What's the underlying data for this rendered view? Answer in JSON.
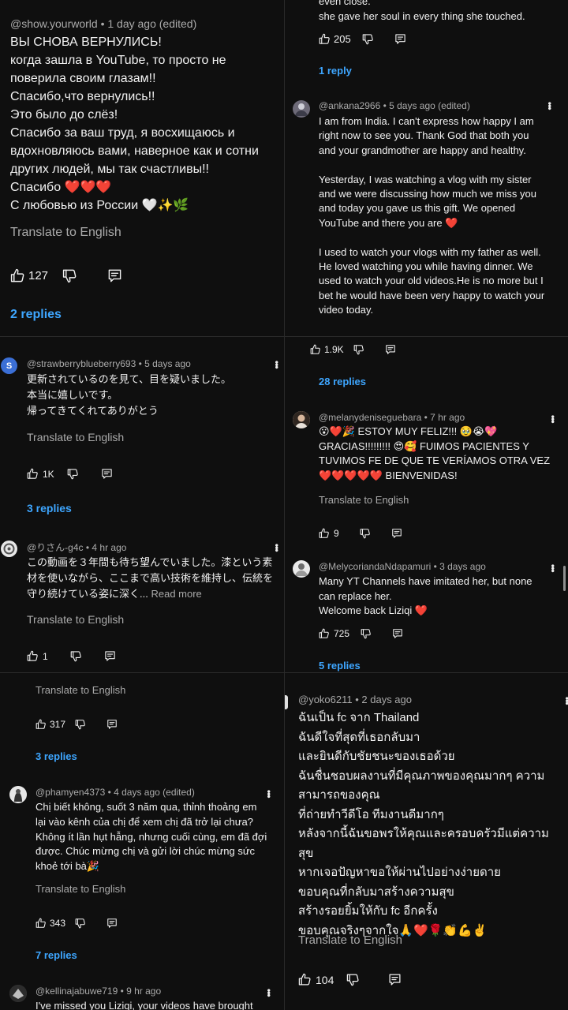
{
  "p1": {
    "meta": "@show.yourworld • 1 day ago (edited)",
    "text": "ВЫ СНОВА ВЕРНУЛИСЬ!\nкогда зашла в YouTube, то просто не поверила своим глазам!!\nСпасибо,что вернулись!!\nЭто было до слёз!\nСпасибо за ваш труд, я восхищаюсь и вдохновляюсь вами, наверное как и сотни других людей, мы так счастливы!!\nСпасибо ❤️❤️❤️\nС любовью из России 🤍✨🌿",
    "translate": "Translate to English",
    "likes": "127",
    "replies": "2 replies"
  },
  "p2": {
    "top_text": "even close.\nshe gave her soul in every thing she touched.",
    "top_likes": "205",
    "top_replies": "1 reply",
    "meta": "@ankana2966 • 5 days ago (edited)",
    "text": "I am from India. I can't express how happy I am right now to see you. Thank God that both you and your grandmother are happy and healthy.\n\nYesterday, I was watching a vlog with my sister and we were discussing how much we miss you and today you gave us this gift. We opened YouTube and there you are ❤️\n\nI used to watch your vlogs with my father as well. He loved watching you while having dinner. We used to watch your old videos.He is no more but I bet he would have been very happy to watch your video today.",
    "likes": "1.9K",
    "replies": "28 replies"
  },
  "p3": {
    "c1": {
      "avatar_letter": "S",
      "meta": "@strawberryblueberry693 • 5 days ago",
      "text": "更新されているのを見て、目を疑いました。\n本当に嬉しいです。\n帰ってきてくれてありがとう",
      "translate": "Translate to English",
      "likes": "1K",
      "replies": "3 replies"
    },
    "c2": {
      "meta": "@りさん-g4c • 4 hr ago",
      "text": "この動画を３年間も待ち望んでいました。漆という素材を使いながら、ここまで高い技術を維持し、伝統を守り続けている姿に深く...",
      "read_more": "Read more",
      "translate": "Translate to English",
      "likes": "1"
    }
  },
  "p4": {
    "c1": {
      "meta": "@melanydeniseguebara • 7 hr ago",
      "text": "😮❤️🎉 ESTOY MUY FELIZ!!! 🥹😭💖 GRACIAS!!!!!!!!! 😍🥰 FUIMOS PACIENTES Y TUVIMOS FE DE QUE TE VERÍAMOS OTRA VEZ ❤️❤️❤️❤️❤️ BIENVENIDAS!",
      "translate": "Translate to English",
      "likes": "9"
    },
    "c2": {
      "meta": "@MelycoriandaNdapamuri • 3 days ago",
      "text": "Many YT Channels have imitated her, but none can replace her.\nWelcome back Liziqi ❤️",
      "likes": "725",
      "replies": "5 replies"
    }
  },
  "p5": {
    "top_translate": "Translate to English",
    "top_likes": "317",
    "top_replies": "3 replies",
    "c1": {
      "meta": "@phamyen4373 • 4 days ago (edited)",
      "text": "Chị biết không, suốt 3 năm qua, thỉnh thoảng em lại vào kênh của chị để xem chị đã trở lại chưa? Không ít lần hụt hẫng, nhưng cuối cùng, em đã đợi được. Chúc mừng chị và gửi lời chúc mừng sức khoẻ tới bà🎉",
      "translate": "Translate to English",
      "likes": "343",
      "replies": "7 replies"
    },
    "c2": {
      "meta": "@kellinajabuwe719 • 9 hr ago",
      "text": "I've missed you Liziqi, your videos have brought"
    }
  },
  "p6": {
    "meta": "@yoko6211 • 2 days ago",
    "text": "ฉันเป็น fc จาก Thailand\nฉันดีใจที่สุดที่เธอกลับมา\nและยินดีกับชัยชนะของเธอด้วย\nฉันชื่นชอบผลงานที่มีคุณภาพของคุณมากๆ ความสามารถของคุณ\nที่ถ่ายทำวีดีโอ ทีมงานดีมากๆ\nหลังจากนี้ฉันขอพรให้คุณและครอบครัวมีแต่ความสุข\nหากเจอปัญหาขอให้ผ่านไปอย่างง่ายดาย\nขอบคุณที่กลับมาสร้างความสุข\nสร้างรอยยิ้มให้กับ fc อีกครั้ง\nขอบคุณจริงๆจากใจ🙏❤️🌹👏💪✌️",
    "translate": "Translate to English",
    "likes": "104"
  },
  "colors": {
    "background": "#0f0f0f",
    "text": "#f1f1f1",
    "meta": "#aaaaaa",
    "link": "#3ea6ff",
    "divider": "#2a2a2a"
  },
  "icons": [
    "thumbs-up-icon",
    "thumbs-down-icon",
    "comment-reply-icon",
    "more-vert-icon"
  ]
}
